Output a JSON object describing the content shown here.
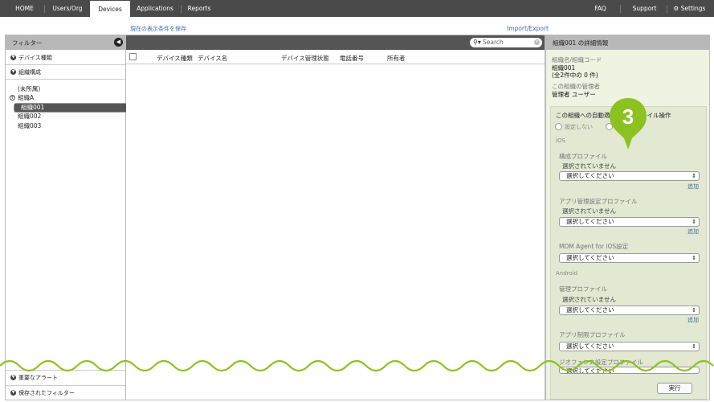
{
  "nav": {
    "tabs": [
      {
        "label": "HOME"
      },
      {
        "label": "Users/Org"
      },
      {
        "label": "Devices"
      },
      {
        "label": "Applications"
      },
      {
        "label": "Reports"
      }
    ],
    "right": {
      "faq": "FAQ",
      "support": "Support",
      "settings": "Settings"
    }
  },
  "toolbar": {
    "save_view": "現在の表示条件を保存",
    "import_export": "Import/Export"
  },
  "filter": {
    "title": "フィルター",
    "facets": [
      {
        "label": "デバイス種類"
      },
      {
        "label": "組織構成"
      }
    ],
    "tree": [
      {
        "label": "(未所属)"
      },
      {
        "label": "組織A"
      },
      {
        "label": "組織001"
      },
      {
        "label": "組織002"
      },
      {
        "label": "組織003"
      }
    ],
    "bottom": [
      {
        "label": "重要なアラート"
      },
      {
        "label": "保存されたフィルター"
      }
    ]
  },
  "search": {
    "placeholder": "Search"
  },
  "table": {
    "columns": [
      "デバイス種類",
      "デバイス名",
      "デバイス管理状態",
      "電話番号",
      "所有者"
    ]
  },
  "details": {
    "title": "組織001 の詳細情報",
    "name_label": "組織名/組織コード",
    "name_value": "組織001",
    "count_value": "(全2件中の 0 件)",
    "admin_label": "この組織の管理者",
    "admin_value": "管理者 ユーザー",
    "op_title": "この組織への自動適",
    "op_title_tail": "イル操作",
    "radio_none": "設定しない",
    "ios_label": "iOS",
    "profile_label": "構成プロファイル",
    "not_selected": "選択されていません",
    "select_placeholder": "選択してください",
    "add": "追加",
    "app_profile_label": "アプリ管理設定プロファイル",
    "mdm_agent_label": "MDM Agent for iOS設定",
    "android_label": "Android",
    "mgmt_profile_label": "管理プロファイル",
    "app_restrict_label": "アプリ制限プロファイル",
    "fence_label": "ジオフェンス設定プロファイル",
    "run": "実行"
  },
  "marker": {
    "number": "3",
    "color": "#8cc21f"
  },
  "colors": {
    "nav_bg": "#4a4a4a",
    "accent_green": "#8cc21f",
    "link": "#3a6ea5"
  }
}
